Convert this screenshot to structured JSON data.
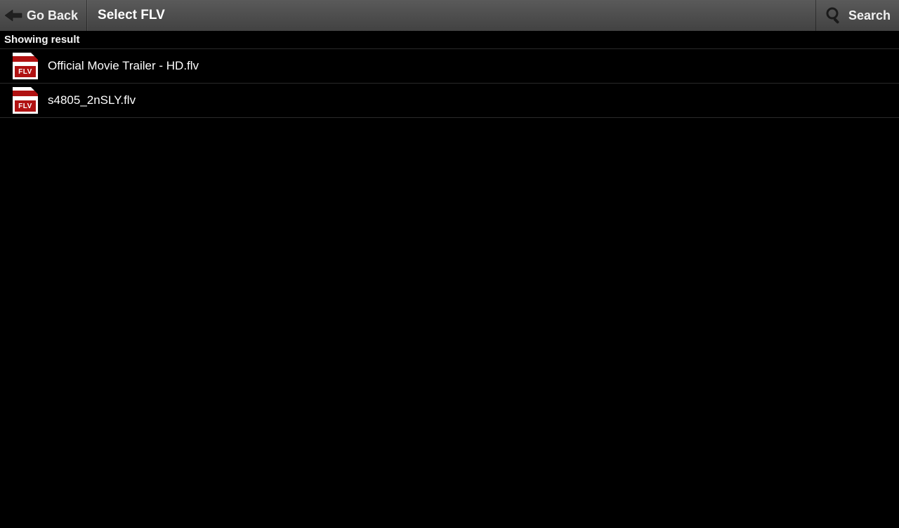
{
  "header": {
    "back_label": "Go Back",
    "title": "Select FLV",
    "search_label": "Search"
  },
  "status": {
    "text": "Showing result"
  },
  "icon_badge_text": "FLV",
  "files": [
    {
      "name": "Official Movie Trailer - HD.flv"
    },
    {
      "name": "s4805_2nSLY.flv"
    }
  ]
}
